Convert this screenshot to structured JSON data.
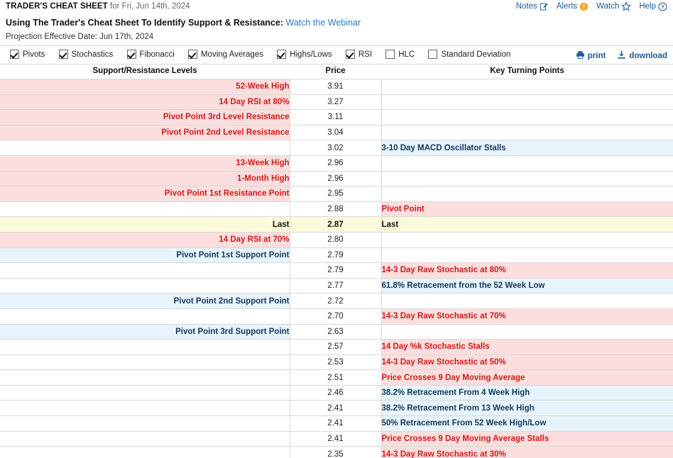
{
  "header": {
    "title": "TRADER'S CHEAT SHEET",
    "for_date": "for Fri, Jun 14th, 2024",
    "nav": [
      {
        "label": "Notes",
        "icon": "notes-pencil-icon"
      },
      {
        "label": "Alerts",
        "icon": "alert-exclamation-icon"
      },
      {
        "label": "Watch",
        "icon": "watch-star-icon"
      },
      {
        "label": "Help",
        "icon": "help-question-icon"
      }
    ]
  },
  "webinar": {
    "text": "Using The Trader's Cheat Sheet To Identify Support & Resistance:",
    "link_label": "Watch the Webinar"
  },
  "projection": "Projection Effective Date: Jun 17th, 2024",
  "toolbar": {
    "filters": [
      {
        "label": "Pivots",
        "checked": true
      },
      {
        "label": "Stochastics",
        "checked": true
      },
      {
        "label": "Fibonacci",
        "checked": true
      },
      {
        "label": "Moving Averages",
        "checked": true
      },
      {
        "label": "Highs/Lows",
        "checked": true
      },
      {
        "label": "RSI",
        "checked": true
      },
      {
        "label": "HLC",
        "checked": false
      },
      {
        "label": "Standard Deviation",
        "checked": false
      }
    ],
    "print_label": "print",
    "download_label": "download"
  },
  "table": {
    "columns": [
      "Support/Resistance Levels",
      "Price",
      "Key Turning Points"
    ],
    "rows": [
      {
        "level": "52-Week High",
        "price": "3.91",
        "ktp": "",
        "level_tone": "red",
        "ktp_tone": "plain"
      },
      {
        "level": "14 Day RSI at 80%",
        "price": "3.27",
        "ktp": "",
        "level_tone": "red",
        "ktp_tone": "plain"
      },
      {
        "level": "Pivot Point 3rd Level Resistance",
        "price": "3.11",
        "ktp": "",
        "level_tone": "red",
        "ktp_tone": "plain"
      },
      {
        "level": "Pivot Point 2nd Level Resistance",
        "price": "3.04",
        "ktp": "",
        "level_tone": "red",
        "ktp_tone": "plain"
      },
      {
        "level": "",
        "price": "3.02",
        "ktp": "3-10 Day MACD Oscillator Stalls",
        "level_tone": "plain",
        "ktp_tone": "blue"
      },
      {
        "level": "13-Week High",
        "price": "2.96",
        "ktp": "",
        "level_tone": "red",
        "ktp_tone": "plain"
      },
      {
        "level": "1-Month High",
        "price": "2.96",
        "ktp": "",
        "level_tone": "red",
        "ktp_tone": "plain"
      },
      {
        "level": "Pivot Point 1st Resistance Point",
        "price": "2.95",
        "ktp": "",
        "level_tone": "red",
        "ktp_tone": "plain"
      },
      {
        "level": "",
        "price": "2.88",
        "ktp": "Pivot Point",
        "level_tone": "plain",
        "ktp_tone": "red"
      },
      {
        "level": "Last",
        "price": "2.87",
        "ktp": "Last",
        "level_tone": "yellow",
        "ktp_tone": "yellow"
      },
      {
        "level": "14 Day RSI at 70%",
        "price": "2.80",
        "ktp": "",
        "level_tone": "red",
        "ktp_tone": "plain"
      },
      {
        "level": "Pivot Point 1st Support Point",
        "price": "2.79",
        "ktp": "",
        "level_tone": "blue",
        "ktp_tone": "plain"
      },
      {
        "level": "",
        "price": "2.79",
        "ktp": "14-3 Day Raw Stochastic at 80%",
        "level_tone": "plain",
        "ktp_tone": "red"
      },
      {
        "level": "",
        "price": "2.77",
        "ktp": "61.8% Retracement from the 52 Week Low",
        "level_tone": "plain",
        "ktp_tone": "blue"
      },
      {
        "level": "Pivot Point 2nd Support Point",
        "price": "2.72",
        "ktp": "",
        "level_tone": "blue",
        "ktp_tone": "plain"
      },
      {
        "level": "",
        "price": "2.70",
        "ktp": "14-3 Day Raw Stochastic at 70%",
        "level_tone": "plain",
        "ktp_tone": "red"
      },
      {
        "level": "Pivot Point 3rd Support Point",
        "price": "2.63",
        "ktp": "",
        "level_tone": "blue",
        "ktp_tone": "plain"
      },
      {
        "level": "",
        "price": "2.57",
        "ktp": "14 Day %k Stochastic Stalls",
        "level_tone": "plain",
        "ktp_tone": "red"
      },
      {
        "level": "",
        "price": "2.53",
        "ktp": "14-3 Day Raw Stochastic at 50%",
        "level_tone": "plain",
        "ktp_tone": "red"
      },
      {
        "level": "",
        "price": "2.51",
        "ktp": "Price Crosses 9 Day Moving Average",
        "level_tone": "plain",
        "ktp_tone": "red"
      },
      {
        "level": "",
        "price": "2.46",
        "ktp": "38.2% Retracement From 4 Week High",
        "level_tone": "plain",
        "ktp_tone": "blue"
      },
      {
        "level": "",
        "price": "2.41",
        "ktp": "38.2% Retracement From 13 Week High",
        "level_tone": "plain",
        "ktp_tone": "blue"
      },
      {
        "level": "",
        "price": "2.41",
        "ktp": "50% Retracement From 52 Week High/Low",
        "level_tone": "plain",
        "ktp_tone": "blue"
      },
      {
        "level": "",
        "price": "2.41",
        "ktp": "Price Crosses 9 Day Moving Average Stalls",
        "level_tone": "plain",
        "ktp_tone": "red"
      },
      {
        "level": "",
        "price": "2.35",
        "ktp": "14-3 Day Raw Stochastic at 30%",
        "level_tone": "plain",
        "ktp_tone": "red"
      }
    ]
  },
  "colors": {
    "red_bg": "#fcdede",
    "red_text": "#d01b1b",
    "blue_bg": "#e7f4fc",
    "blue_text": "#17375e",
    "yellow_bg": "#fbfbdb",
    "link": "#2b7bba",
    "tool": "#1a5a96",
    "alert_orange": "#f5a623"
  }
}
